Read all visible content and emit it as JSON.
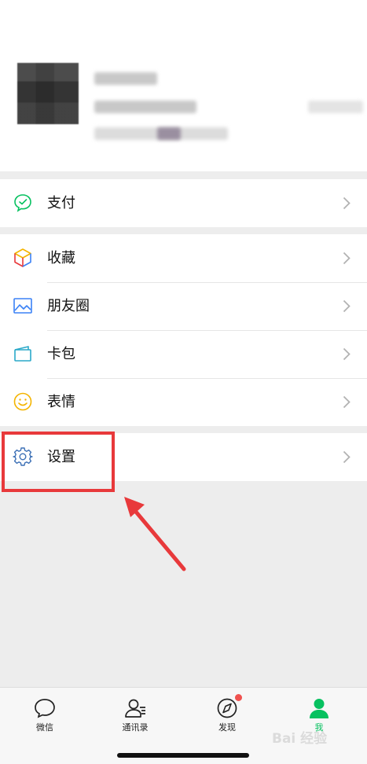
{
  "menu": {
    "pay": "支付",
    "favorites": "收藏",
    "moments": "朋友圈",
    "cards": "卡包",
    "stickers": "表情",
    "settings": "设置"
  },
  "tabbar": {
    "chats": "微信",
    "contacts": "通讯录",
    "discover": "发现",
    "me": "我"
  },
  "watermark": "Bai 经验",
  "colors": {
    "accent_green": "#07c160",
    "highlight_red": "#e8393b",
    "badge_red": "#f0524f"
  }
}
